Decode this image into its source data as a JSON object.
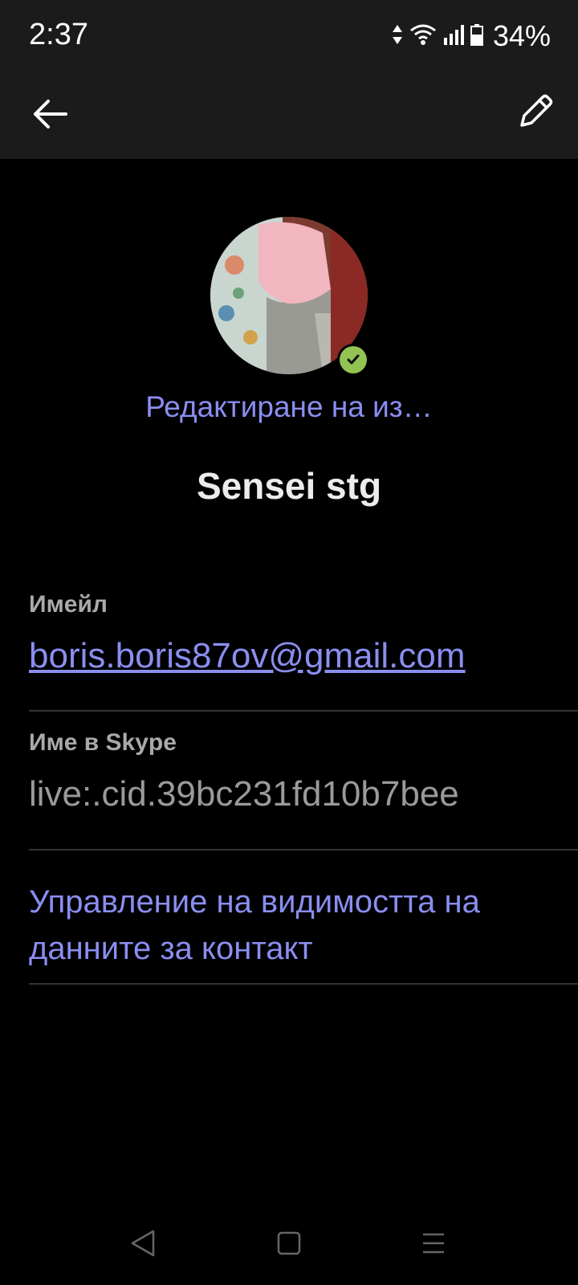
{
  "status_bar": {
    "time": "2:37",
    "battery_percent": "34%",
    "icons": [
      "data-arrows-icon",
      "wifi-icon",
      "signal-icon",
      "battery-icon"
    ]
  },
  "app_bar": {
    "back_icon": "arrow-left-icon",
    "edit_icon": "pencil-icon"
  },
  "profile": {
    "edit_photo_label": "Редактиране на из…",
    "display_name": "Sensei stg",
    "presence": "available",
    "presence_color": "#92c353"
  },
  "fields": {
    "email_label": "Имейл",
    "email_value": "boris.boris87ov@gmail.com",
    "skype_label": "Име в Skype",
    "skype_value": "live:.cid.39bc231fd10b7bee"
  },
  "manage_visibility_label": "Управление на видимостта на данните за контакт",
  "nav_bar": {
    "icons": [
      "nav-back-icon",
      "nav-home-icon",
      "nav-recents-icon"
    ]
  },
  "colors": {
    "accent": "#8a8ef0",
    "background": "#000000",
    "bar": "#1b1b1b"
  }
}
